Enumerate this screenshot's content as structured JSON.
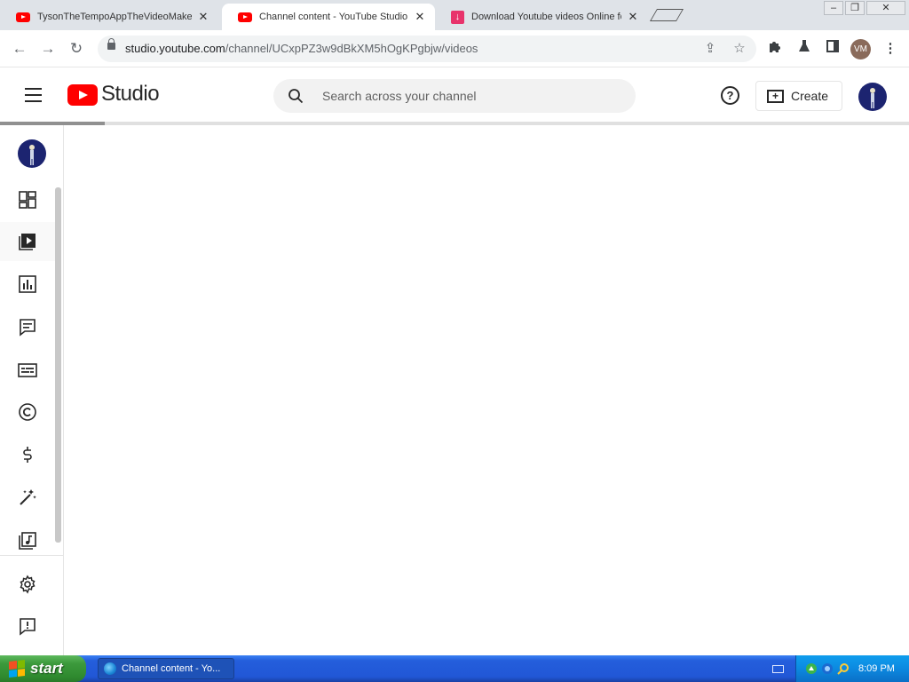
{
  "browser": {
    "tabs": [
      {
        "title": "TysonTheTempoAppTheVideoMaker",
        "icon": "youtube-favicon",
        "active": false
      },
      {
        "title": "Channel content - YouTube Studio",
        "icon": "youtube-favicon",
        "active": true
      },
      {
        "title": "Download Youtube videos Online fo",
        "icon": "download-favicon",
        "active": false
      }
    ],
    "close_glyph": "✕",
    "url_host": "studio.youtube.com",
    "url_path": "/channel/UCxpPZ3w9dBkXM5hOgKPgbjw/videos",
    "profile_initials": "VM",
    "window_controls": {
      "minimize": "–",
      "restore": "❐",
      "close": "✕"
    }
  },
  "studio": {
    "logo_text": "Studio",
    "search_placeholder": "Search across your channel",
    "help_glyph": "?",
    "create_label": "Create",
    "create_glyph": "+",
    "loading_fraction": 0.115,
    "sidebar": [
      {
        "name": "dashboard",
        "icon": "dashboard-icon",
        "active": false
      },
      {
        "name": "content",
        "icon": "content-icon",
        "active": true
      },
      {
        "name": "analytics",
        "icon": "analytics-icon",
        "active": false
      },
      {
        "name": "comments",
        "icon": "comments-icon",
        "active": false
      },
      {
        "name": "subtitles",
        "icon": "subtitles-icon",
        "active": false
      },
      {
        "name": "copyright",
        "icon": "copyright-icon",
        "active": false
      },
      {
        "name": "earn",
        "icon": "monetization-icon",
        "active": false
      },
      {
        "name": "customization",
        "icon": "customization-icon",
        "active": false
      },
      {
        "name": "audio-library",
        "icon": "audio-library-icon",
        "active": false
      },
      {
        "name": "settings",
        "icon": "settings-icon",
        "active": false
      },
      {
        "name": "send-feedback",
        "icon": "feedback-icon",
        "active": false
      }
    ]
  },
  "taskbar": {
    "start_label": "start",
    "task_title": "Channel content - Yo...",
    "clock": "8:09 PM"
  },
  "colors": {
    "youtube_red": "#ff0000",
    "taskbar_blue": "#245edc",
    "start_green": "#3c9a3c",
    "avatar_navy": "#1c2470"
  }
}
